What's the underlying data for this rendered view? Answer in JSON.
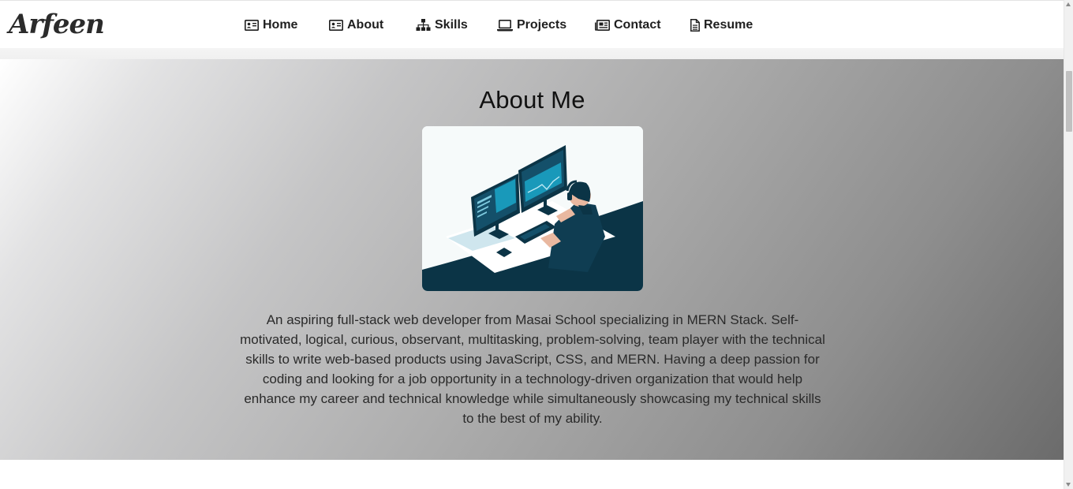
{
  "brand": {
    "logo_text": "Arfeen"
  },
  "nav": {
    "items": [
      {
        "label": "Home",
        "icon": "id-card-icon"
      },
      {
        "label": "About",
        "icon": "id-card-icon"
      },
      {
        "label": "Skills",
        "icon": "sitemap-icon"
      },
      {
        "label": "Projects",
        "icon": "laptop-icon"
      },
      {
        "label": "Contact",
        "icon": "newspaper-icon"
      },
      {
        "label": "Resume",
        "icon": "file-icon"
      }
    ]
  },
  "about": {
    "title": "About Me",
    "image_alt": "developer working at two monitors illustration",
    "description": "An aspiring full-stack web developer from Masai School specializing in MERN Stack. Self-motivated, logical, curious, observant, multitasking, problem-solving, team player with the technical skills to write web-based products using JavaScript, CSS, and MERN. Having a deep passion for coding and looking for a job opportunity in a technology-driven organization that would help enhance my career and technical knowledge while simultaneously showcasing my technical skills to the best of my ability."
  },
  "colors": {
    "illustration_dark": "#0b3446",
    "illustration_accent": "#1aa6c8",
    "text": "#2a2a2a"
  }
}
